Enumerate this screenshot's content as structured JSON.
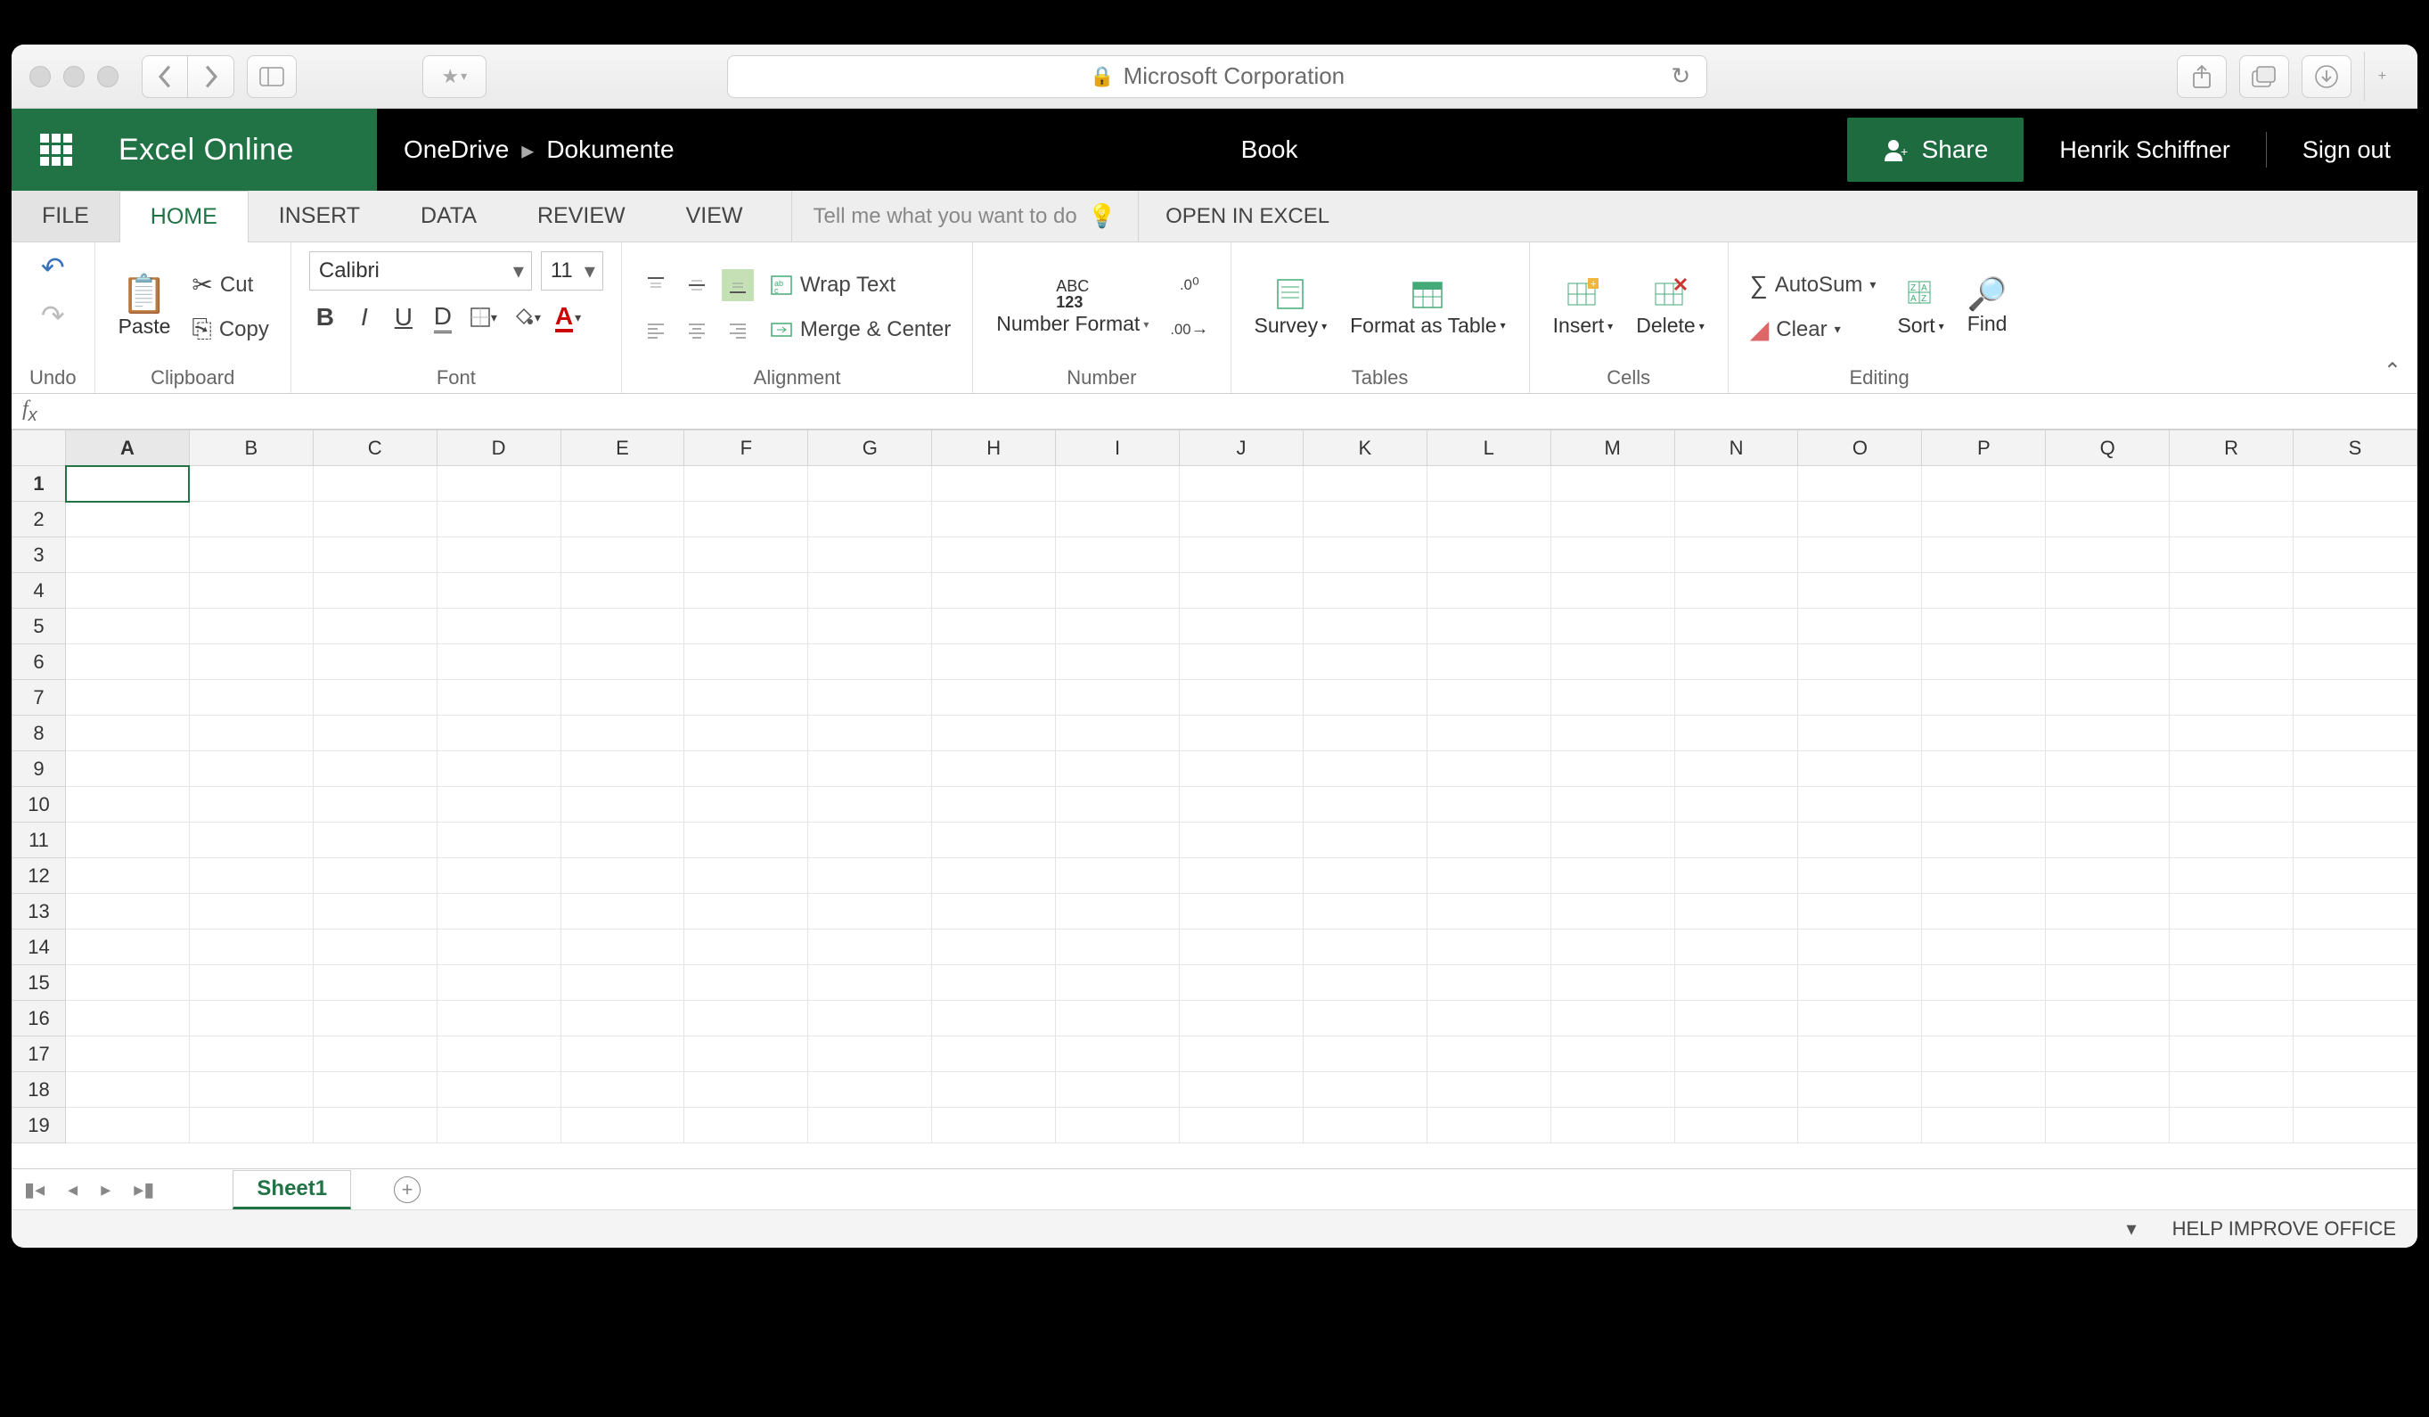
{
  "safari": {
    "domain": "Microsoft Corporation"
  },
  "header": {
    "brand": "Excel Online",
    "breadcrumb": [
      "OneDrive",
      "Dokumente"
    ],
    "doc_title": "Book",
    "share": "Share",
    "user": "Henrik Schiffner",
    "signout": "Sign out"
  },
  "tabs": {
    "items": [
      "FILE",
      "HOME",
      "INSERT",
      "DATA",
      "REVIEW",
      "VIEW"
    ],
    "active": "HOME",
    "tellme_placeholder": "Tell me what you want to do",
    "open_in": "OPEN IN EXCEL"
  },
  "ribbon": {
    "undo": {
      "label": "Undo"
    },
    "clipboard": {
      "label": "Clipboard",
      "paste": "Paste",
      "cut": "Cut",
      "copy": "Copy"
    },
    "font": {
      "label": "Font",
      "name": "Calibri",
      "size": "11"
    },
    "alignment": {
      "label": "Alignment",
      "wrap": "Wrap Text",
      "merge": "Merge & Center"
    },
    "number": {
      "label": "Number",
      "format_btn": "Number Format"
    },
    "tables": {
      "label": "Tables",
      "survey": "Survey",
      "format_table": "Format as Table"
    },
    "cells": {
      "label": "Cells",
      "insert": "Insert",
      "delete": "Delete"
    },
    "editing": {
      "label": "Editing",
      "autosum": "AutoSum",
      "clear": "Clear",
      "sort": "Sort",
      "find": "Find"
    }
  },
  "grid": {
    "columns": [
      "A",
      "B",
      "C",
      "D",
      "E",
      "F",
      "G",
      "H",
      "I",
      "J",
      "K",
      "L",
      "M",
      "N",
      "O",
      "P",
      "Q",
      "R",
      "S"
    ],
    "rows": [
      1,
      2,
      3,
      4,
      5,
      6,
      7,
      8,
      9,
      10,
      11,
      12,
      13,
      14,
      15,
      16,
      17,
      18,
      19
    ],
    "active_cell": "A1"
  },
  "sheets": {
    "active": "Sheet1"
  },
  "status": {
    "help": "HELP IMPROVE OFFICE"
  }
}
